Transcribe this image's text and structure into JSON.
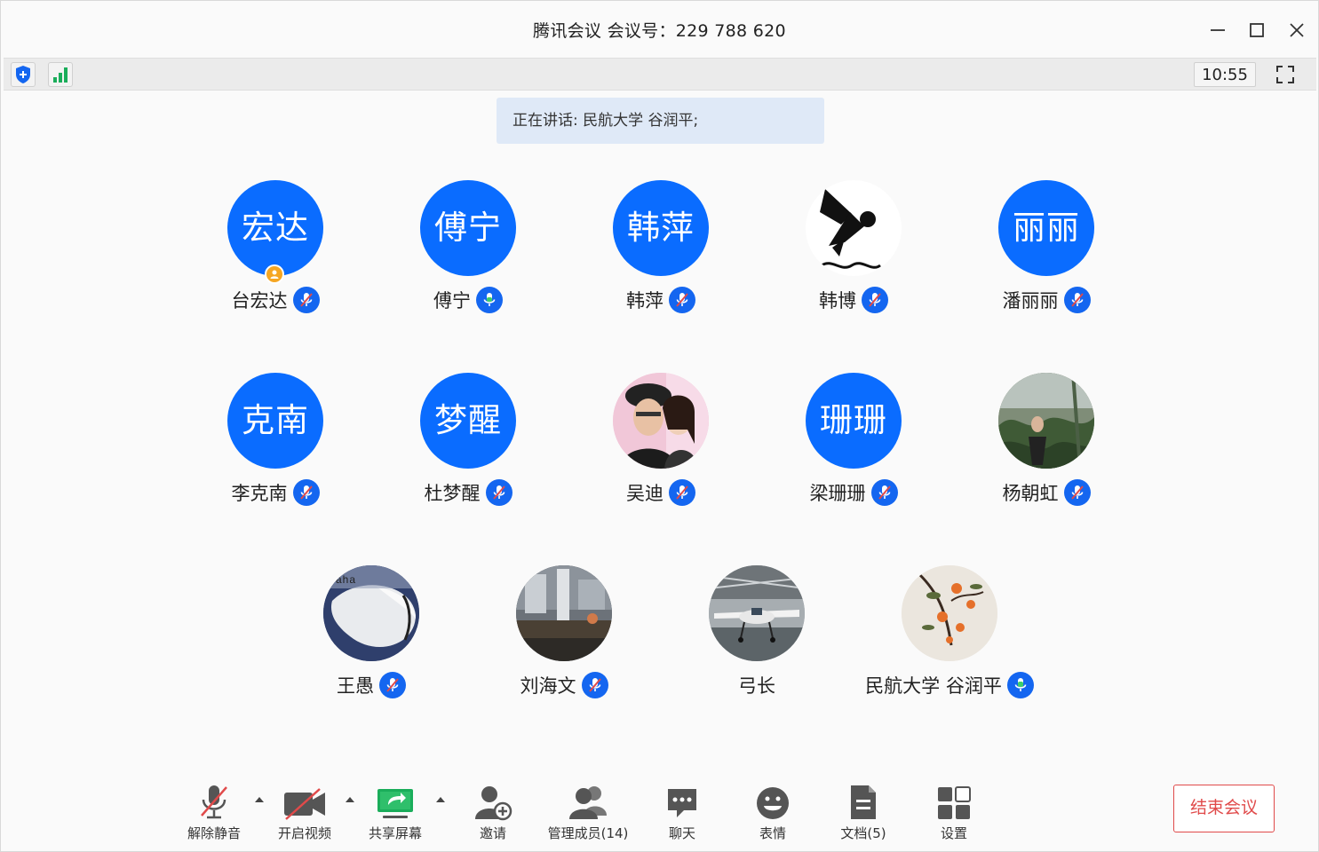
{
  "window": {
    "title": "腾讯会议 会议号：229 788 620"
  },
  "infobar": {
    "time": "10:55"
  },
  "speaking": {
    "text": "正在讲话: 民航大学 谷润平;"
  },
  "participants": [
    {
      "name": "台宏达",
      "avatar_text": "宏达",
      "mic": "muted",
      "host": true
    },
    {
      "name": "傅宁",
      "avatar_text": "傅宁",
      "mic": "active"
    },
    {
      "name": "韩萍",
      "avatar_text": "韩萍",
      "mic": "muted"
    },
    {
      "name": "韩博",
      "avatar_text": "",
      "avatar_image": "swimmer-pictogram",
      "mic": "muted"
    },
    {
      "name": "潘丽丽",
      "avatar_text": "丽丽",
      "mic": "muted"
    },
    {
      "name": "李克南",
      "avatar_text": "克南",
      "mic": "muted"
    },
    {
      "name": "杜梦醒",
      "avatar_text": "梦醒",
      "mic": "muted"
    },
    {
      "name": "吴迪",
      "avatar_text": "",
      "avatar_image": "couple-photo",
      "mic": "muted"
    },
    {
      "name": "梁珊珊",
      "avatar_text": "珊珊",
      "mic": "muted"
    },
    {
      "name": "杨朝虹",
      "avatar_text": "",
      "avatar_image": "garden-photo",
      "mic": "muted"
    },
    {
      "name": "王愚",
      "avatar_text": "",
      "avatar_image": "aircraft-nose-photo",
      "mic": "muted"
    },
    {
      "name": "刘海文",
      "avatar_text": "",
      "avatar_image": "interior-photo",
      "mic": "muted"
    },
    {
      "name": "弓长",
      "avatar_text": "",
      "avatar_image": "hangar-plane-photo",
      "mic": "none"
    },
    {
      "name": "民航大学 谷润平",
      "avatar_text": "",
      "avatar_image": "persimmon-painting",
      "mic": "speaking"
    }
  ],
  "toolbar": {
    "unmute": "解除静音",
    "start_video": "开启视频",
    "share_screen": "共享屏幕",
    "invite": "邀请",
    "manage_members": "管理成员(14)",
    "chat": "聊天",
    "emoji": "表情",
    "docs": "文档(5)",
    "settings": "设置",
    "end_meeting": "结束会议"
  },
  "colors": {
    "accent_blue": "#0a6cff",
    "mic_blue": "#1466f0",
    "end_red": "#e04a4a",
    "share_green": "#1aad5a"
  }
}
